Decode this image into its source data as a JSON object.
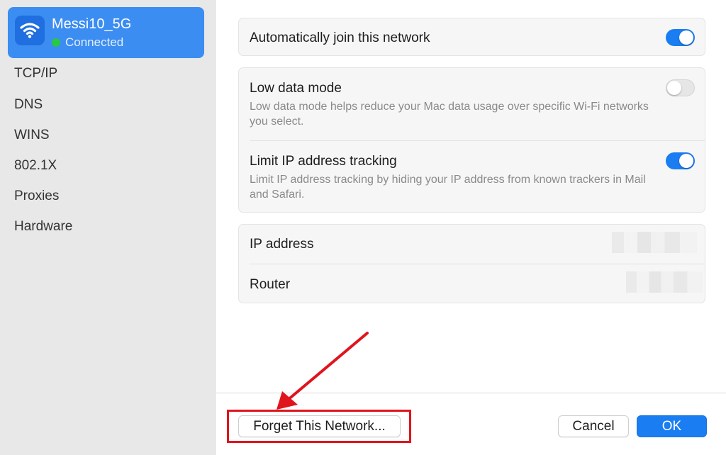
{
  "network": {
    "name": "Messi10_5G",
    "status": "Connected"
  },
  "sidebar": {
    "items": [
      {
        "label": "TCP/IP"
      },
      {
        "label": "DNS"
      },
      {
        "label": "WINS"
      },
      {
        "label": "802.1X"
      },
      {
        "label": "Proxies"
      },
      {
        "label": "Hardware"
      }
    ]
  },
  "settings": {
    "auto_join": {
      "label": "Automatically join this network",
      "enabled": true
    },
    "low_data": {
      "label": "Low data mode",
      "description": "Low data mode helps reduce your Mac data usage over specific Wi-Fi networks you select.",
      "enabled": false
    },
    "limit_ip": {
      "label": "Limit IP address tracking",
      "description": "Limit IP address tracking by hiding your IP address from known trackers in Mail and Safari.",
      "enabled": true
    },
    "ip_address": {
      "label": "IP address"
    },
    "router": {
      "label": "Router"
    }
  },
  "footer": {
    "forget_label": "Forget This Network...",
    "cancel_label": "Cancel",
    "ok_label": "OK"
  },
  "colors": {
    "accent": "#1a7df2",
    "selection": "#3b8df2",
    "annotation": "#e0141c",
    "status_green": "#28c840"
  },
  "icons": [
    "wifi-icon",
    "status-dot",
    "annotation-arrow"
  ]
}
